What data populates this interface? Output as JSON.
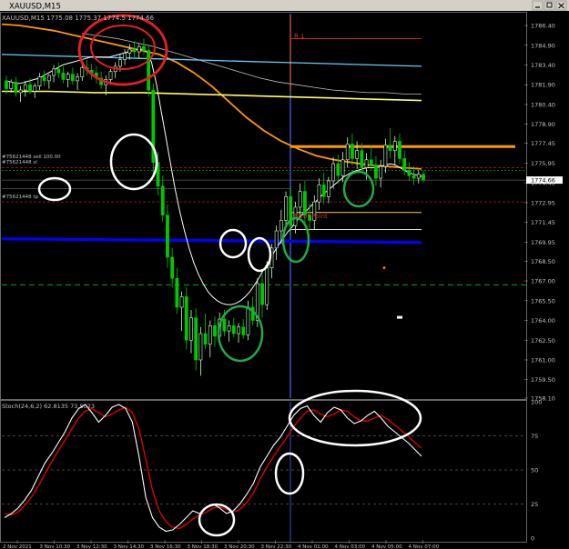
{
  "window": {
    "title": "XAUUSD,M15",
    "titlebar": {
      "bg": "#d4d0c8",
      "fg": "#000000"
    },
    "buttons": [
      "minimize",
      "restore",
      "close"
    ]
  },
  "main_header": "XAUUSD,M15  1775.08  1775.37  1774.5  1774.66",
  "osc_header": "Stoch(24,6,2) 62.8135 73.5023",
  "labels": {
    "r1": "R 1",
    "pivot": "Pivot Point",
    "order_sl": "#75621448 sell 100.00",
    "order_sl2": "#75621448 sl",
    "order_tp": "#75621448 tp"
  },
  "colors": {
    "background": "#000000",
    "grid": "#303030",
    "up_candle": "#ccffcc",
    "down_candle": "#00c800",
    "ma_white": "#ffffff",
    "ma_silver": "#c0c0c0",
    "ma_orange": "#ff9900",
    "ma_lightblue": "#66ccff",
    "ma_yellow": "#ffff66",
    "blue_line": "#0000ff",
    "r1_line": "#cc2222",
    "pivot_line": "#ffcc66",
    "vline": "#4466ff",
    "stoch_main": "#ffffff",
    "stoch_signal": "#dd0000"
  },
  "chart_data": [
    {
      "type": "candlestick",
      "title": "",
      "ylim": [
        1758.1,
        1787.3
      ],
      "ytick_labels": [
        "1786.40",
        "1784.90",
        "1783.40",
        "1781.90",
        "1780.40",
        "1778.90",
        "1777.45",
        "1775.95",
        "1774.45",
        "1772.95",
        "1771.45",
        "1769.95",
        "1768.50",
        "1767.00",
        "1765.50",
        "1764.00",
        "1762.50",
        "1761.00",
        "1759.50",
        "1758.10"
      ],
      "xtick_labels": [
        "2 Nov 2021",
        "3 Nov 10:30",
        "3 Nov 12:30",
        "3 Nov 14:30",
        "3 Nov 16:30",
        "3 Nov 18:30",
        "3 Nov 20:30",
        "3 Nov 22:30",
        "4 Nov 01:00",
        "4 Nov 03:00",
        "4 Nov 05:00",
        "4 Nov 07:00"
      ],
      "current_price": 1774.66,
      "grid": true,
      "candles": [
        [
          1782.2,
          1782.6,
          1781.2,
          1781.6
        ],
        [
          1781.6,
          1782.3,
          1781.3,
          1782.1
        ],
        [
          1782.1,
          1782.5,
          1781.0,
          1781.3
        ],
        [
          1781.3,
          1781.8,
          1780.6,
          1781.5
        ],
        [
          1781.5,
          1782.2,
          1781.0,
          1781.9
        ],
        [
          1781.9,
          1782.4,
          1781.2,
          1781.4
        ],
        [
          1781.4,
          1782.0,
          1780.9,
          1781.8
        ],
        [
          1781.8,
          1782.8,
          1781.5,
          1782.5
        ],
        [
          1782.5,
          1783.0,
          1781.8,
          1782.2
        ],
        [
          1782.2,
          1782.7,
          1781.6,
          1782.6
        ],
        [
          1782.6,
          1783.4,
          1782.1,
          1783.1
        ],
        [
          1783.1,
          1783.6,
          1782.4,
          1782.8
        ],
        [
          1782.8,
          1783.3,
          1782.0,
          1782.3
        ],
        [
          1782.3,
          1782.9,
          1781.7,
          1782.7
        ],
        [
          1782.7,
          1783.2,
          1781.9,
          1782.2
        ],
        [
          1782.2,
          1782.8,
          1781.5,
          1782.5
        ],
        [
          1782.5,
          1783.5,
          1782.2,
          1783.2
        ],
        [
          1783.2,
          1783.8,
          1782.6,
          1783.0
        ],
        [
          1783.0,
          1783.5,
          1782.3,
          1782.8
        ],
        [
          1782.8,
          1783.3,
          1782.0,
          1782.4
        ],
        [
          1782.4,
          1782.9,
          1781.6,
          1781.9
        ],
        [
          1781.9,
          1782.6,
          1781.1,
          1782.3
        ],
        [
          1782.3,
          1783.1,
          1781.9,
          1782.9
        ],
        [
          1782.9,
          1783.6,
          1782.4,
          1783.3
        ],
        [
          1783.3,
          1784.2,
          1782.9,
          1783.8
        ],
        [
          1783.8,
          1784.6,
          1783.4,
          1784.3
        ],
        [
          1784.3,
          1785.0,
          1783.8,
          1784.6
        ],
        [
          1784.6,
          1785.2,
          1784.0,
          1784.4
        ],
        [
          1784.4,
          1785.0,
          1783.9,
          1784.8
        ],
        [
          1784.8,
          1785.4,
          1784.2,
          1784.5
        ],
        [
          1784.5,
          1784.9,
          1781.0,
          1781.5
        ],
        [
          1781.5,
          1782.0,
          1775.0,
          1776.0
        ],
        [
          1776.0,
          1776.8,
          1773.5,
          1774.2
        ],
        [
          1774.2,
          1775.0,
          1771.5,
          1772.0
        ],
        [
          1772.0,
          1772.8,
          1768.0,
          1768.8
        ],
        [
          1768.8,
          1769.5,
          1766.5,
          1767.2
        ],
        [
          1767.2,
          1768.0,
          1764.5,
          1765.0
        ],
        [
          1765.0,
          1766.2,
          1763.2,
          1765.8
        ],
        [
          1765.8,
          1766.5,
          1761.8,
          1762.5
        ],
        [
          1762.5,
          1764.8,
          1761.5,
          1764.2
        ],
        [
          1764.2,
          1764.9,
          1760.2,
          1761.0
        ],
        [
          1761.0,
          1763.5,
          1759.8,
          1763.0
        ],
        [
          1763.0,
          1764.5,
          1761.8,
          1762.2
        ],
        [
          1762.2,
          1764.0,
          1761.2,
          1763.6
        ],
        [
          1763.6,
          1764.3,
          1762.0,
          1762.8
        ],
        [
          1762.8,
          1764.6,
          1762.2,
          1764.1
        ],
        [
          1764.1,
          1764.8,
          1762.8,
          1763.2
        ],
        [
          1763.2,
          1764.0,
          1762.4,
          1763.6
        ],
        [
          1763.6,
          1764.2,
          1762.7,
          1763.0
        ],
        [
          1763.0,
          1763.8,
          1762.3,
          1763.5
        ],
        [
          1763.5,
          1764.1,
          1762.6,
          1762.9
        ],
        [
          1762.9,
          1765.5,
          1762.5,
          1765.0
        ],
        [
          1765.0,
          1765.8,
          1763.6,
          1764.0
        ],
        [
          1764.0,
          1767.2,
          1763.5,
          1766.8
        ],
        [
          1766.8,
          1767.5,
          1764.2,
          1765.2
        ],
        [
          1765.2,
          1768.5,
          1764.8,
          1768.0
        ],
        [
          1768.0,
          1769.8,
          1767.2,
          1769.5
        ],
        [
          1769.5,
          1771.2,
          1768.6,
          1770.8
        ],
        [
          1770.8,
          1772.4,
          1769.8,
          1771.6
        ],
        [
          1771.6,
          1773.8,
          1771.0,
          1773.4
        ],
        [
          1773.4,
          1774.2,
          1770.5,
          1771.2
        ],
        [
          1771.2,
          1773.0,
          1770.6,
          1772.6
        ],
        [
          1772.6,
          1774.4,
          1771.9,
          1773.8
        ],
        [
          1773.8,
          1774.6,
          1771.4,
          1772.0
        ],
        [
          1772.0,
          1772.9,
          1770.8,
          1771.6
        ],
        [
          1771.6,
          1773.5,
          1770.9,
          1773.0
        ],
        [
          1773.0,
          1774.8,
          1772.4,
          1774.3
        ],
        [
          1774.3,
          1775.2,
          1772.8,
          1773.4
        ],
        [
          1773.4,
          1774.9,
          1772.9,
          1774.6
        ],
        [
          1774.6,
          1776.4,
          1774.0,
          1775.9
        ],
        [
          1775.9,
          1776.6,
          1774.4,
          1775.0
        ],
        [
          1775.0,
          1776.8,
          1774.5,
          1776.2
        ],
        [
          1776.2,
          1777.9,
          1775.6,
          1777.4
        ],
        [
          1777.4,
          1778.2,
          1775.8,
          1776.3
        ],
        [
          1776.3,
          1777.6,
          1775.5,
          1776.9
        ],
        [
          1776.9,
          1777.5,
          1775.2,
          1775.6
        ],
        [
          1775.6,
          1776.7,
          1774.7,
          1776.2
        ],
        [
          1776.2,
          1777.2,
          1775.4,
          1775.8
        ],
        [
          1775.8,
          1776.5,
          1774.2,
          1774.8
        ],
        [
          1774.8,
          1776.2,
          1774.1,
          1775.7
        ],
        [
          1775.7,
          1777.8,
          1775.2,
          1777.3
        ],
        [
          1777.3,
          1778.6,
          1776.3,
          1776.9
        ],
        [
          1776.9,
          1778.0,
          1775.8,
          1777.6
        ],
        [
          1777.6,
          1778.2,
          1775.9,
          1776.3
        ],
        [
          1776.3,
          1776.9,
          1775.0,
          1775.4
        ],
        [
          1775.4,
          1776.0,
          1774.6,
          1775.0
        ],
        [
          1775.0,
          1775.7,
          1774.3,
          1774.8
        ],
        [
          1774.8,
          1775.4,
          1774.4,
          1775.1
        ],
        [
          1775.1,
          1775.4,
          1774.5,
          1774.66
        ]
      ],
      "ma_white": [
        1782.2,
        1782.1,
        1782.0,
        1782.0,
        1782.1,
        1782.2,
        1782.3,
        1782.4,
        1782.6,
        1782.8,
        1783.0,
        1783.2,
        1783.4,
        1783.5,
        1783.6,
        1783.7,
        1783.8,
        1783.9,
        1784.0,
        1784.0,
        1784.0,
        1784.0,
        1784.0,
        1784.1,
        1784.2,
        1784.3,
        1784.4,
        1784.5,
        1784.6,
        1784.6,
        1784.4,
        1783.6,
        1782.0,
        1780.0,
        1778.0,
        1776.0,
        1774.0,
        1772.3,
        1770.8,
        1769.5,
        1768.4,
        1767.5,
        1766.8,
        1766.2,
        1765.8,
        1765.5,
        1765.3,
        1765.2,
        1765.2,
        1765.3,
        1765.5,
        1765.8,
        1766.2,
        1766.7,
        1767.3,
        1767.9,
        1768.5,
        1769.1,
        1769.7,
        1770.2,
        1770.7,
        1771.1,
        1771.6,
        1772.0,
        1772.3,
        1772.7,
        1773.0,
        1773.4,
        1773.7,
        1774.0,
        1774.3,
        1774.6,
        1774.9,
        1775.1,
        1775.3,
        1775.4,
        1775.5,
        1775.6,
        1775.6,
        1775.6,
        1775.7,
        1775.8,
        1775.9,
        1775.8,
        1775.6,
        1775.4,
        1775.2,
        1775.1,
        1775.0,
        1774.9
      ],
      "ma_silver": [
        1785.8,
        1785.6,
        1785.4,
        1785.1,
        1784.8,
        1784.4,
        1784.0,
        1783.6,
        1783.2,
        1782.8,
        1782.4,
        1782.1,
        1781.9,
        1781.7,
        1781.5,
        1781.4,
        1781.3,
        1781.3,
        1781.2,
        1781.2
      ],
      "ma_orange": [
        1786.5,
        1786.4,
        1786.2,
        1786.0,
        1785.7,
        1785.4,
        1785.1,
        1784.8,
        1784.5,
        1784.2,
        1783.6,
        1782.8,
        1781.8,
        1780.6,
        1779.4,
        1778.4,
        1777.6,
        1777.0,
        1776.5,
        1776.2,
        1776.0,
        1775.8,
        1775.7,
        1775.6,
        1775.5
      ],
      "ma_lightblue": [
        1784.2,
        1784.1,
        1784.0,
        1783.9,
        1783.8,
        1783.7,
        1783.6,
        1783.5,
        1783.4,
        1783.3
      ],
      "ma_yellow": [
        1781.4,
        1781.4,
        1781.3,
        1781.3,
        1781.2,
        1781.1,
        1781.0,
        1780.9,
        1780.8,
        1780.7
      ],
      "hlines": {
        "blue": 1770.2,
        "r1": 1785.4,
        "pivot": 1772.2,
        "dark_red": 1775.6,
        "green": 1766.7,
        "orange": 1777.2,
        "sell_dotted": 1775.4,
        "tp_dotted": 1773.0
      },
      "markers": [
        {
          "price": 1768.0,
          "color": "#ff6633"
        }
      ]
    },
    {
      "type": "line",
      "title": "Stochastic(24,6,2)",
      "ylim": [
        0,
        100
      ],
      "ytick_labels": [
        "100",
        "75",
        "50",
        "25",
        "0"
      ],
      "levels": [
        75,
        50,
        25
      ],
      "series": [
        {
          "name": "main",
          "values": [
            15,
            18,
            22,
            28,
            35,
            45,
            55,
            62,
            70,
            78,
            88,
            95,
            98,
            92,
            85,
            90,
            96,
            98,
            95,
            85,
            60,
            30,
            15,
            8,
            5,
            6,
            10,
            15,
            20,
            18,
            22,
            25,
            22,
            18,
            20,
            25,
            32,
            40,
            52,
            60,
            68,
            74,
            82,
            90,
            95,
            97,
            90,
            85,
            92,
            96,
            94,
            88,
            84,
            86,
            90,
            93,
            88,
            82,
            78,
            74,
            70,
            65,
            60
          ]
        },
        {
          "name": "signal",
          "values": [
            18,
            17,
            19,
            24,
            30,
            38,
            47,
            56,
            64,
            72,
            80,
            88,
            93,
            95,
            92,
            89,
            91,
            94,
            96,
            92,
            80,
            58,
            35,
            20,
            12,
            8,
            7,
            10,
            14,
            17,
            19,
            22,
            23,
            21,
            19,
            21,
            26,
            33,
            43,
            52,
            60,
            67,
            74,
            82,
            88,
            93,
            94,
            91,
            89,
            91,
            94,
            93,
            89,
            86,
            86,
            88,
            90,
            87,
            83,
            79,
            75,
            70,
            66
          ]
        }
      ]
    }
  ],
  "annotations": [
    {
      "shape": "ellipse",
      "color": "#e02020",
      "label": "top"
    },
    {
      "shape": "ellipse",
      "color": "#ffffff",
      "label": "drop"
    },
    {
      "shape": "ellipse",
      "color": "#ffffff",
      "label": "order-labels"
    },
    {
      "shape": "ellipse",
      "color": "#ffffff",
      "label": "blue-touch-1"
    },
    {
      "shape": "ellipse",
      "color": "#ffffff",
      "label": "blue-touch-2"
    },
    {
      "shape": "ellipse",
      "color": "#22aa44",
      "label": "low"
    },
    {
      "shape": "ellipse",
      "color": "#22aa44",
      "label": "pivot-break"
    },
    {
      "shape": "ellipse",
      "color": "#22aa44",
      "label": "pullback"
    },
    {
      "shape": "ellipse",
      "color": "#ffffff",
      "label": "osc-top"
    },
    {
      "shape": "ellipse",
      "color": "#ffffff",
      "label": "osc-cross"
    },
    {
      "shape": "ellipse",
      "color": "#ffffff",
      "label": "osc-bottom"
    }
  ]
}
